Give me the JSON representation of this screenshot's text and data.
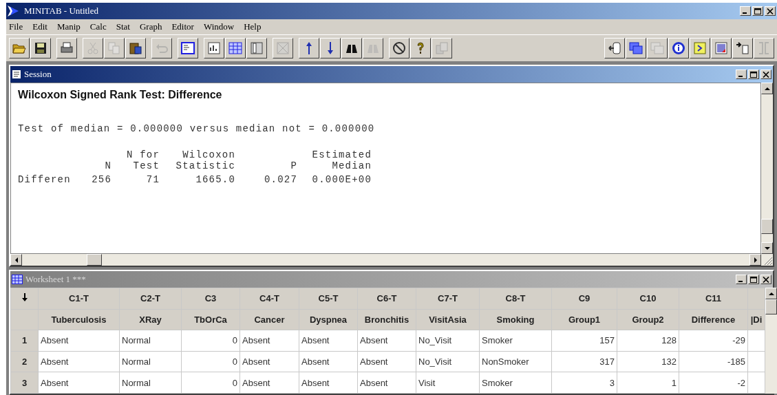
{
  "window": {
    "title": "MINITAB - Untitled"
  },
  "menu": [
    "File",
    "Edit",
    "Manip",
    "Calc",
    "Stat",
    "Graph",
    "Editor",
    "Window",
    "Help"
  ],
  "toolbar": {
    "left": [
      {
        "kind": "open",
        "disabled": false
      },
      {
        "kind": "save",
        "disabled": false
      },
      {
        "kind": "sep"
      },
      {
        "kind": "print",
        "disabled": false
      },
      {
        "kind": "sep"
      },
      {
        "kind": "cut",
        "disabled": true
      },
      {
        "kind": "copy",
        "disabled": true
      },
      {
        "kind": "paste",
        "disabled": false
      },
      {
        "kind": "sep"
      },
      {
        "kind": "undo",
        "disabled": true
      },
      {
        "kind": "sep"
      },
      {
        "kind": "session",
        "disabled": false
      },
      {
        "kind": "sep"
      },
      {
        "kind": "graphs",
        "disabled": false
      },
      {
        "kind": "worksheet",
        "disabled": false
      },
      {
        "kind": "columns",
        "disabled": false
      },
      {
        "kind": "sep"
      },
      {
        "kind": "closegraph",
        "disabled": true
      },
      {
        "kind": "sep"
      },
      {
        "kind": "up",
        "disabled": false
      },
      {
        "kind": "down",
        "disabled": false
      },
      {
        "kind": "find",
        "disabled": false
      },
      {
        "kind": "replace",
        "disabled": true
      },
      {
        "kind": "sep"
      },
      {
        "kind": "cancel",
        "disabled": false
      },
      {
        "kind": "help",
        "disabled": false
      },
      {
        "kind": "manager",
        "disabled": true
      }
    ],
    "right": [
      {
        "kind": "report",
        "disabled": false
      },
      {
        "kind": "project",
        "disabled": false
      },
      {
        "kind": "folder2",
        "disabled": true
      },
      {
        "kind": "info",
        "disabled": false
      },
      {
        "kind": "history",
        "disabled": false
      },
      {
        "kind": "graphs2",
        "disabled": false
      },
      {
        "kind": "related",
        "disabled": false
      },
      {
        "kind": "design",
        "disabled": true
      }
    ]
  },
  "session": {
    "title": "Session",
    "active": true,
    "heading": "Wilcoxon Signed Rank Test: Difference",
    "test_line": "Test of median = 0.000000 versus median not = 0.000000",
    "stats_table": {
      "columns": [
        {},
        {
          "header": [
            "N"
          ]
        },
        {
          "header": [
            "N for",
            "Test"
          ]
        },
        {
          "header": [
            "Wilcoxon",
            "Statistic"
          ]
        },
        {
          "header": [
            "P"
          ]
        },
        {
          "header": [
            "Estimated",
            "Median"
          ]
        }
      ],
      "rows": [
        {
          "cells": [
            "Differen",
            "256",
            "71",
            "1665.0",
            "0.027",
            "0.000E+00"
          ]
        }
      ]
    }
  },
  "worksheet": {
    "title": "Worksheet 1 ***",
    "active": false,
    "columns": [
      {
        "id": "C1-T",
        "name": "Tuberculosis",
        "kind": "text"
      },
      {
        "id": "C2-T",
        "name": "XRay",
        "kind": "text"
      },
      {
        "id": "C3",
        "name": "TbOrCa",
        "kind": "numeric"
      },
      {
        "id": "C4-T",
        "name": "Cancer",
        "kind": "text"
      },
      {
        "id": "C5-T",
        "name": "Dyspnea",
        "kind": "text"
      },
      {
        "id": "C6-T",
        "name": "Bronchitis",
        "kind": "text"
      },
      {
        "id": "C7-T",
        "name": "VisitAsia",
        "kind": "text"
      },
      {
        "id": "C8-T",
        "name": "Smoking",
        "kind": "text"
      },
      {
        "id": "C9",
        "name": "Group1",
        "kind": "numeric"
      },
      {
        "id": "C10",
        "name": "Group2",
        "kind": "numeric"
      },
      {
        "id": "C11",
        "name": "Difference",
        "kind": "numeric"
      },
      {
        "name": "|Di"
      }
    ],
    "rows": [
      {
        "number": "1",
        "cells": [
          "Absent",
          "Normal",
          "0",
          "Absent",
          "Absent",
          "Absent",
          "No_Visit",
          "Smoker",
          "157",
          "128",
          "-29"
        ]
      },
      {
        "number": "2",
        "cells": [
          "Absent",
          "Normal",
          "0",
          "Absent",
          "Absent",
          "Absent",
          "No_Visit",
          "NonSmoker",
          "317",
          "132",
          "-185"
        ]
      },
      {
        "number": "3",
        "cells": [
          "Absent",
          "Normal",
          "0",
          "Absent",
          "Absent",
          "Absent",
          "Visit",
          "Smoker",
          "3",
          "1",
          "-2"
        ]
      }
    ]
  }
}
